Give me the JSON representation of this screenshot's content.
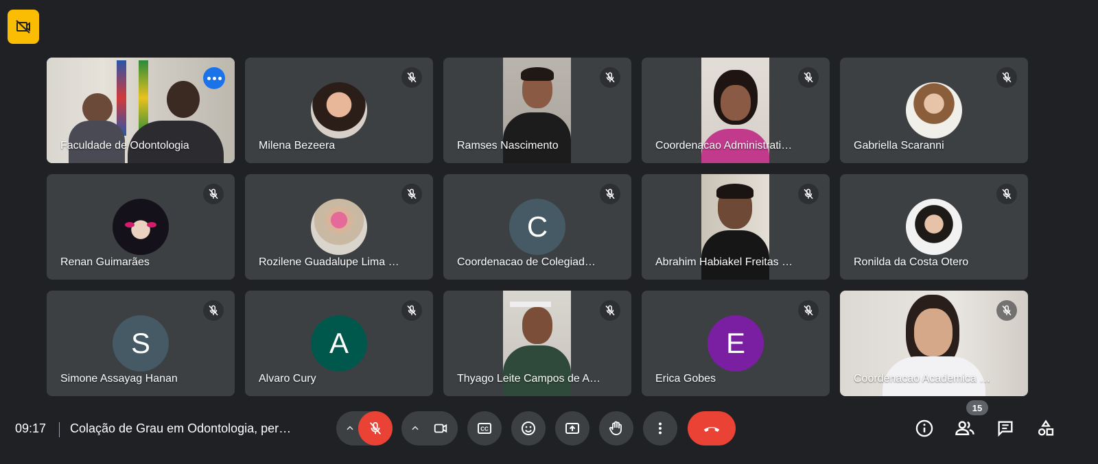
{
  "participants": [
    {
      "name": "Faculdade de Odontologia"
    },
    {
      "name": "Milena Bezeera"
    },
    {
      "name": "Ramses Nascimento"
    },
    {
      "name": "Coordenacao Administrati…"
    },
    {
      "name": "Gabriella Scaranni"
    },
    {
      "name": "Renan Guimarães"
    },
    {
      "name": "Rozilene Guadalupe Lima …"
    },
    {
      "name": "Coordenacao de Colegiad…",
      "initial": "C",
      "color": "#455a64"
    },
    {
      "name": "Abrahim Habiakel Freitas …"
    },
    {
      "name": "Ronilda da Costa Otero"
    },
    {
      "name": "Simone Assayag Hanan",
      "initial": "S",
      "color": "#455a64"
    },
    {
      "name": "Alvaro Cury",
      "initial": "A",
      "color": "#00574b"
    },
    {
      "name": "Thyago Leite Campos de A…"
    },
    {
      "name": "Erica Gobes",
      "initial": "E",
      "color": "#7b1fa2"
    },
    {
      "name": "Coordenacao Academica …"
    }
  ],
  "bottom_bar": {
    "time": "09:17",
    "meeting_title": "Colação de Grau em Odontologia, per…",
    "participant_count": "15"
  },
  "colors": {
    "background": "#202124",
    "tile": "#3c4043",
    "active_border": "#8ab4f8",
    "end_call": "#ea4335",
    "recording": "#fbbc04"
  }
}
